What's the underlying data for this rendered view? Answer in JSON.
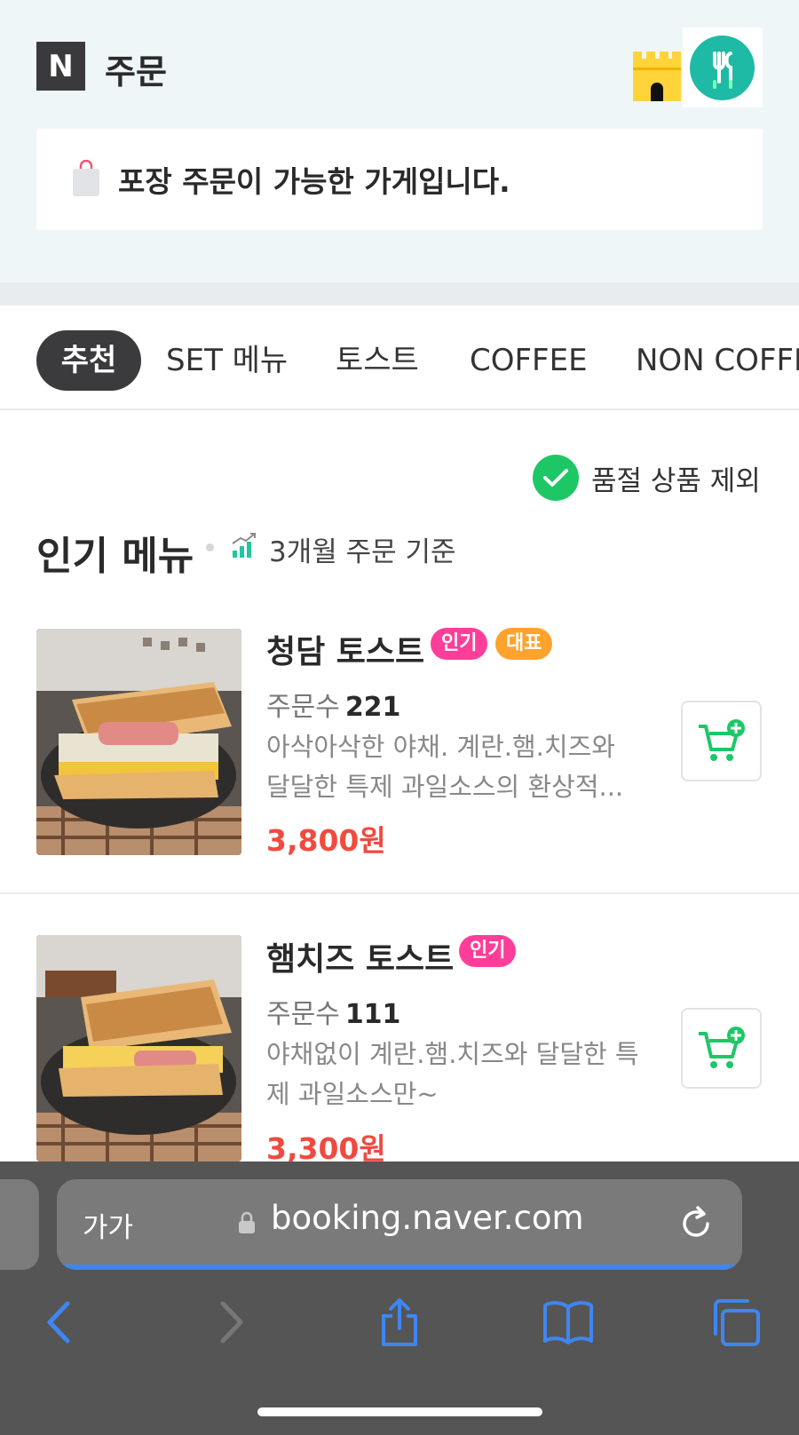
{
  "header": {
    "title": "주문",
    "logo_letter": "N"
  },
  "notice": {
    "text": "포장 주문이 가능한 가게입니다."
  },
  "tabs": [
    {
      "label": "추천",
      "active": true
    },
    {
      "label": "SET 메뉴",
      "active": false
    },
    {
      "label": "토스트",
      "active": false
    },
    {
      "label": "COFFEE",
      "active": false
    },
    {
      "label": "NON COFFEE",
      "active": false
    }
  ],
  "filter": {
    "label": "품절 상품 제외",
    "checked": true
  },
  "section": {
    "title": "인기 메뉴",
    "subtitle": "3개월 주문 기준"
  },
  "items": [
    {
      "name": "청담 토스트",
      "badges": [
        "인기",
        "대표"
      ],
      "orders_label": "주문수",
      "orders": "221",
      "description": "아삭아삭한 야채. 계란.햄.치즈와 달달한 특제 과일소스의 환상적...",
      "price": "3,800원"
    },
    {
      "name": "햄치즈 토스트",
      "badges": [
        "인기"
      ],
      "orders_label": "주문수",
      "orders": "111",
      "description": "야채없이 계란.햄.치즈와 달달한 특제 과일소스만~",
      "price": "3,300원"
    }
  ],
  "browser": {
    "text_size_label": "가가",
    "url": "booking.naver.com"
  },
  "colors": {
    "accent_green": "#1ec766",
    "price_red": "#f04a3f",
    "badge_pink": "#ff3e9a",
    "badge_orange": "#ffa22e",
    "teal": "#1fbaa5",
    "ios_blue": "#3f86f2"
  }
}
